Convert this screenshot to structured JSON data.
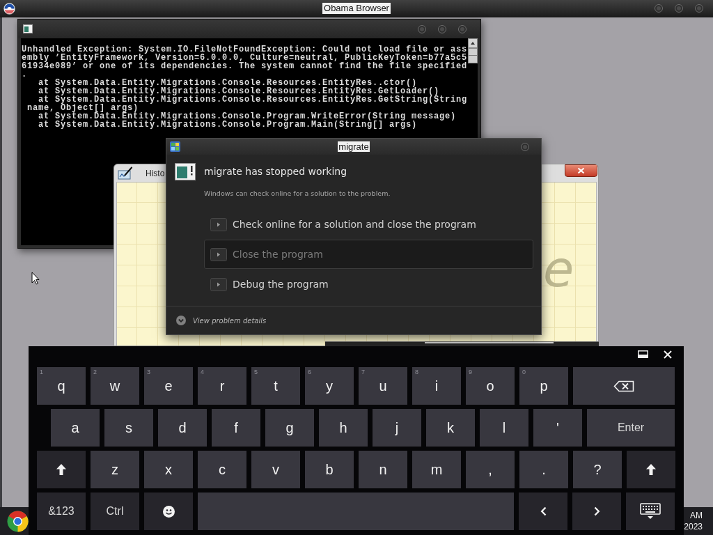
{
  "top_bar": {
    "title": "Obama Browser"
  },
  "console_window": {
    "lines": [
      "Unhandled Exception: System.IO.FileNotFoundException: Could not load file or ass",
      "embly ’EntityFramework, Version=6.0.0.0, Culture=neutral, PublicKeyToken=b77a5c5",
      "61934e089’ or one of its dependencies. The system cannot find the file specified",
      ".",
      "   at System.Data.Entity.Migrations.Console.Resources.EntityRes..ctor()",
      "   at System.Data.Entity.Migrations.Console.Resources.EntityRes.GetLoader()",
      "   at System.Data.Entity.Migrations.Console.Resources.EntityRes.GetString(String",
      " name, Object[] args)",
      "   at System.Data.Entity.Migrations.Console.Program.WriteError(String message)",
      "   at System.Data.Entity.Migrations.Console.Program.Main(String[] args)"
    ]
  },
  "history_window": {
    "title": "Histo",
    "canvas_text": "e"
  },
  "error_dialog": {
    "title": "migrate",
    "heading": "migrate has stopped working",
    "message": "Windows can check online for a solution to the problem.",
    "options": [
      {
        "label": "Check online for a solution and close the program",
        "selected": false
      },
      {
        "label": "Close the program",
        "selected": true
      },
      {
        "label": "Debug the program",
        "selected": false
      }
    ],
    "details_link": "View problem details"
  },
  "keyboard": {
    "rows": [
      {
        "keys": [
          {
            "kind": "letter",
            "label": "q",
            "hint": "1"
          },
          {
            "kind": "letter",
            "label": "w",
            "hint": "2"
          },
          {
            "kind": "letter",
            "label": "e",
            "hint": "3"
          },
          {
            "kind": "letter",
            "label": "r",
            "hint": "4"
          },
          {
            "kind": "letter",
            "label": "t",
            "hint": "5"
          },
          {
            "kind": "letter",
            "label": "y",
            "hint": "6"
          },
          {
            "kind": "letter",
            "label": "u",
            "hint": "7"
          },
          {
            "kind": "letter",
            "label": "i",
            "hint": "8"
          },
          {
            "kind": "letter",
            "label": "o",
            "hint": "9"
          },
          {
            "kind": "letter",
            "label": "p",
            "hint": "0"
          },
          {
            "kind": "backspace"
          }
        ]
      },
      {
        "keys": [
          {
            "kind": "letter",
            "label": "a"
          },
          {
            "kind": "letter",
            "label": "s"
          },
          {
            "kind": "letter",
            "label": "d"
          },
          {
            "kind": "letter",
            "label": "f"
          },
          {
            "kind": "letter",
            "label": "g"
          },
          {
            "kind": "letter",
            "label": "h"
          },
          {
            "kind": "letter",
            "label": "j"
          },
          {
            "kind": "letter",
            "label": "k"
          },
          {
            "kind": "letter",
            "label": "l"
          },
          {
            "kind": "letter",
            "label": "'"
          },
          {
            "kind": "enter",
            "label": "Enter"
          }
        ]
      },
      {
        "keys": [
          {
            "kind": "shift"
          },
          {
            "kind": "letter",
            "label": "z"
          },
          {
            "kind": "letter",
            "label": "x"
          },
          {
            "kind": "letter",
            "label": "c"
          },
          {
            "kind": "letter",
            "label": "v"
          },
          {
            "kind": "letter",
            "label": "b"
          },
          {
            "kind": "letter",
            "label": "n"
          },
          {
            "kind": "letter",
            "label": "m"
          },
          {
            "kind": "letter",
            "label": ","
          },
          {
            "kind": "letter",
            "label": "."
          },
          {
            "kind": "letter",
            "label": "?"
          },
          {
            "kind": "shift"
          }
        ]
      },
      {
        "keys": [
          {
            "kind": "modifier",
            "label": "&123"
          },
          {
            "kind": "modifier",
            "label": "Ctrl"
          },
          {
            "kind": "emoji"
          },
          {
            "kind": "space"
          },
          {
            "kind": "left"
          },
          {
            "kind": "right"
          },
          {
            "kind": "hide"
          }
        ]
      }
    ]
  },
  "taskbar": {
    "clock": [
      "AM",
      "2023"
    ]
  }
}
